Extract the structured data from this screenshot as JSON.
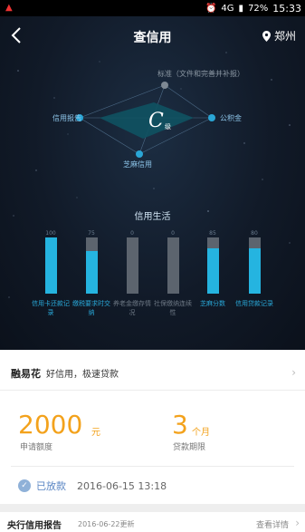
{
  "status_bar": {
    "time": "15:33",
    "battery": "72%",
    "network": "4G"
  },
  "nav": {
    "title": "查信用",
    "location": "郑州"
  },
  "diagram": {
    "grade_letter": "C",
    "grade_suffix": "级",
    "top_label": "标准（文件和完善并补报）",
    "left_label": "信用报告",
    "right_label": "公积金",
    "bottom_label": "芝麻信用"
  },
  "credit_life": {
    "title": "信用生活",
    "bars": [
      {
        "value_label": "100",
        "fill": 1.0,
        "label": "信用卡还款记录",
        "active": true
      },
      {
        "value_label": "75",
        "fill": 0.75,
        "label": "缴税要求时交纳",
        "active": true
      },
      {
        "value_label": "0",
        "fill": 0.0,
        "label": "养老金缴存情况",
        "active": false
      },
      {
        "value_label": "0",
        "fill": 0.0,
        "label": "社保缴纳连续性",
        "active": false
      },
      {
        "value_label": "85",
        "fill": 0.8,
        "label": "芝麻分数",
        "active": true
      },
      {
        "value_label": "80",
        "fill": 0.8,
        "label": "信用贷款记录",
        "active": true
      }
    ]
  },
  "loan_card": {
    "product": "融易花",
    "slogan": "好信用，极速贷款",
    "amount_value": "2000",
    "amount_unit": "元",
    "amount_label": "申请额度",
    "term_value": "3",
    "term_unit": "个月",
    "term_label": "贷款期限",
    "status": "已放款",
    "status_time": "2016-06-15 13:18"
  },
  "bottom": {
    "title": "央行信用报告",
    "date": "2016-06-22更新",
    "link": "查看详情"
  },
  "colors": {
    "accent": "#25b4e0",
    "amount": "#f3a21c",
    "status": "#5a86c4"
  }
}
